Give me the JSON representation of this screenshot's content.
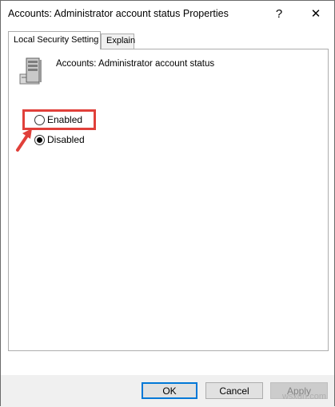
{
  "window": {
    "title": "Accounts: Administrator account status Properties",
    "help_glyph": "?",
    "close_glyph": "✕"
  },
  "tabs": [
    {
      "label": "Local Security Setting",
      "active": true
    },
    {
      "label": "Explain",
      "active": false
    }
  ],
  "policy": {
    "icon": "server-icon",
    "name": "Accounts: Administrator account status"
  },
  "options": {
    "enabled_label": "Enabled",
    "disabled_label": "Disabled",
    "selected": "Disabled"
  },
  "annotation": {
    "highlight_color": "#e0403a"
  },
  "buttons": {
    "ok_label": "OK",
    "cancel_label": "Cancel",
    "apply_label": "Apply"
  },
  "watermark": {
    "text": "wsxdn.com"
  }
}
